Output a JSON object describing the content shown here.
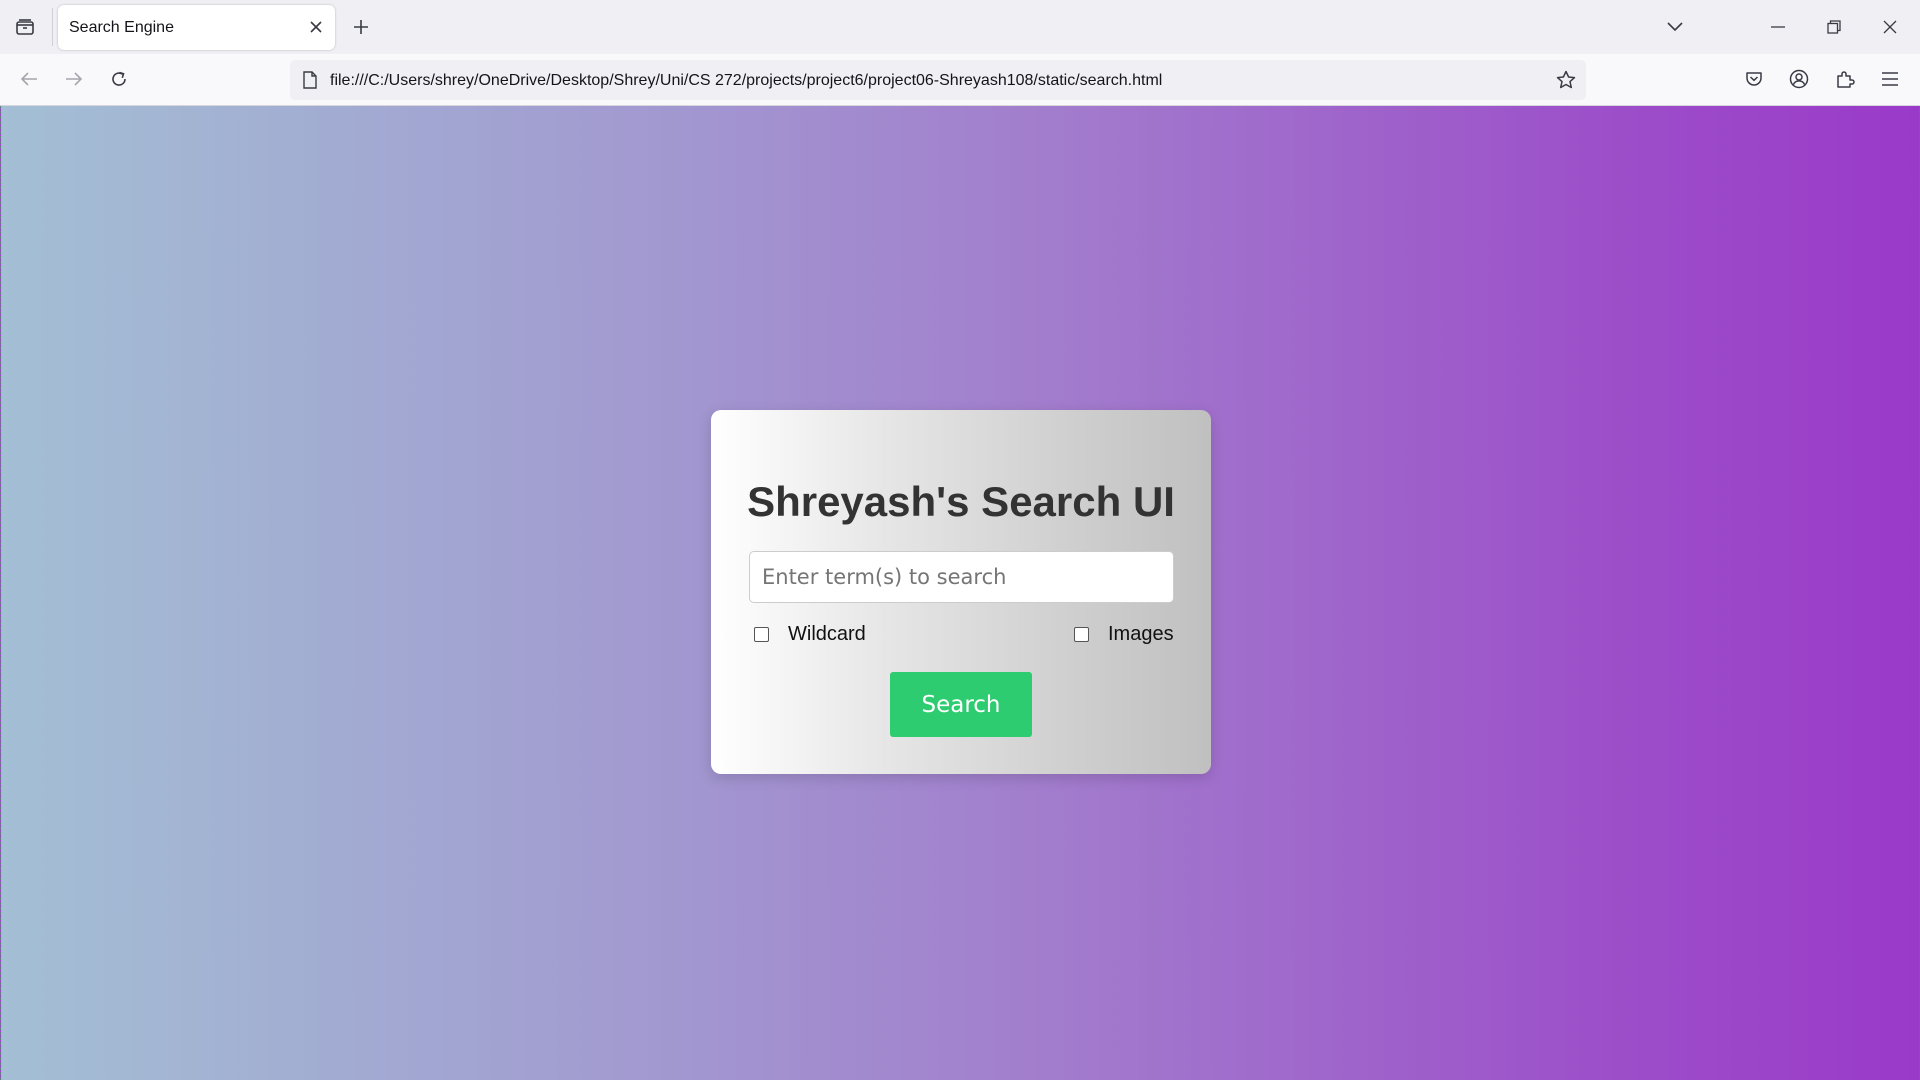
{
  "browser": {
    "tab": {
      "title": "Search Engine"
    },
    "url": "file:///C:/Users/shrey/OneDrive/Desktop/Shrey/Uni/CS 272/projects/project6/project06-Shreyash108/static/search.html"
  },
  "page": {
    "title": "Shreyash's Search UI",
    "search_placeholder": "Enter term(s) to search",
    "options": [
      {
        "label": "Wildcard",
        "checked": false
      },
      {
        "label": "Images",
        "checked": false
      }
    ],
    "search_button": "Search"
  },
  "colors": {
    "button": "#2ecc71",
    "gradient_start": "#a3bfd4",
    "gradient_end": "#9a3ac9"
  }
}
